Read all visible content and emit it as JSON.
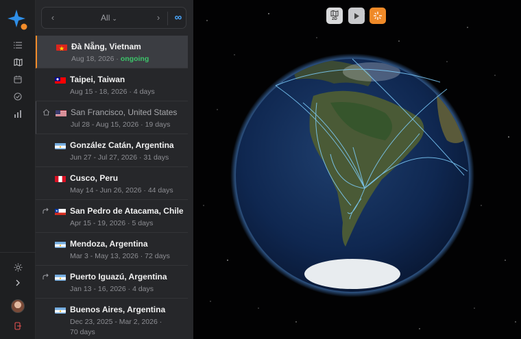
{
  "filter": {
    "label": "All"
  },
  "trips": [
    {
      "country_flag": "vn",
      "name": "Đà Nẵng, Vietnam",
      "dates": "Aug 18, 2026",
      "duration": "",
      "status": "ongoing",
      "lead_icon": ""
    },
    {
      "country_flag": "tw",
      "name": "Taipei, Taiwan",
      "dates": "Aug 15 - 18, 2026",
      "duration": "4 days",
      "status": "",
      "lead_icon": ""
    },
    {
      "country_flag": "us",
      "name": "San Francisco, United States",
      "dates": "Jul 28 - Aug 15, 2026",
      "duration": "19 days",
      "status": "",
      "lead_icon": "home-icon"
    },
    {
      "country_flag": "ar",
      "name": "González Catán, Argentina",
      "dates": "Jun 27 - Jul 27, 2026",
      "duration": "31 days",
      "status": "",
      "lead_icon": ""
    },
    {
      "country_flag": "pe",
      "name": "Cusco, Peru",
      "dates": "May 14 - Jun 26, 2026",
      "duration": "44 days",
      "status": "",
      "lead_icon": ""
    },
    {
      "country_flag": "cl",
      "name": "San Pedro de Atacama, Chile",
      "dates": "Apr 15 - 19, 2026",
      "duration": "5 days",
      "status": "",
      "lead_icon": "route-icon"
    },
    {
      "country_flag": "ar",
      "name": "Mendoza, Argentina",
      "dates": "Mar 3 - May 13, 2026",
      "duration": "72 days",
      "status": "",
      "lead_icon": ""
    },
    {
      "country_flag": "ar",
      "name": "Puerto Iguazú, Argentina",
      "dates": "Jan 13 - 16, 2026",
      "duration": "4 days",
      "status": "",
      "lead_icon": "route-icon"
    },
    {
      "country_flag": "ar",
      "name": "Buenos Aires, Argentina",
      "dates": "Dec 23, 2025 - Mar 2, 2026",
      "duration": "70 days",
      "status": "",
      "lead_icon": ""
    }
  ],
  "toolbar": {
    "map_mode_label": "2D"
  },
  "colors": {
    "accent": "#f28c2a",
    "ongoing": "#3cc46a",
    "link": "#4aa8ff",
    "route": "#7fd0ff"
  }
}
